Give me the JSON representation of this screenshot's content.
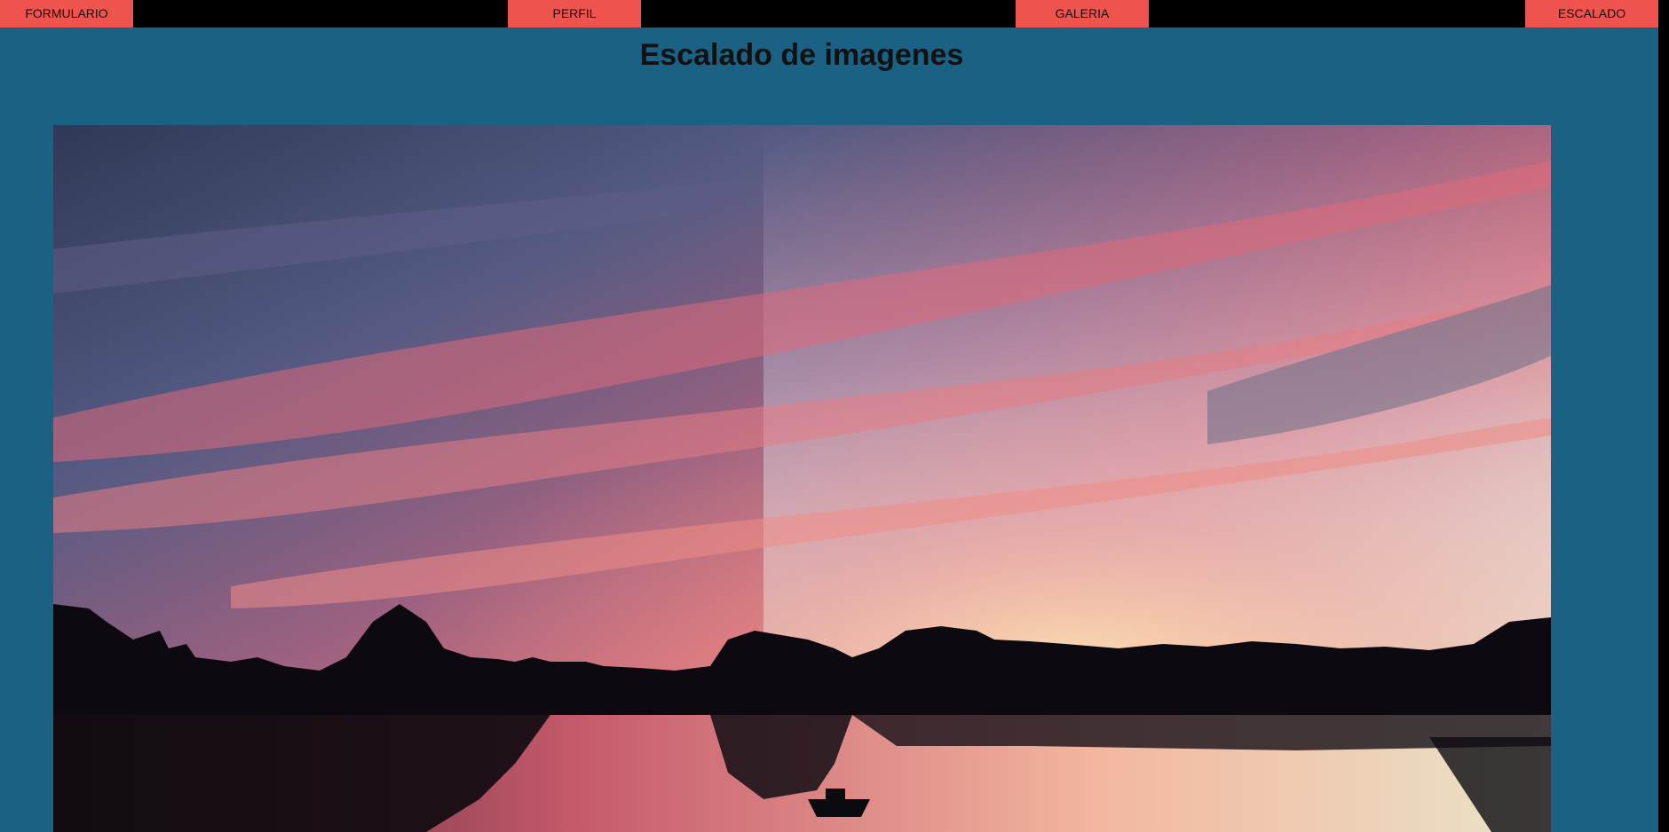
{
  "nav": {
    "items": [
      {
        "label": "FORMULARIO"
      },
      {
        "label": "PERFIL"
      },
      {
        "label": "GALERIA"
      },
      {
        "label": "ESCALADO"
      }
    ]
  },
  "page": {
    "title": "Escalado de imagenes"
  },
  "photo": {
    "description_icon": "sunset-photo"
  },
  "colors": {
    "nav_bar": "#000000",
    "nav_button": "#ef534e",
    "page_background": "#1b6184",
    "title_text": "#111111"
  }
}
